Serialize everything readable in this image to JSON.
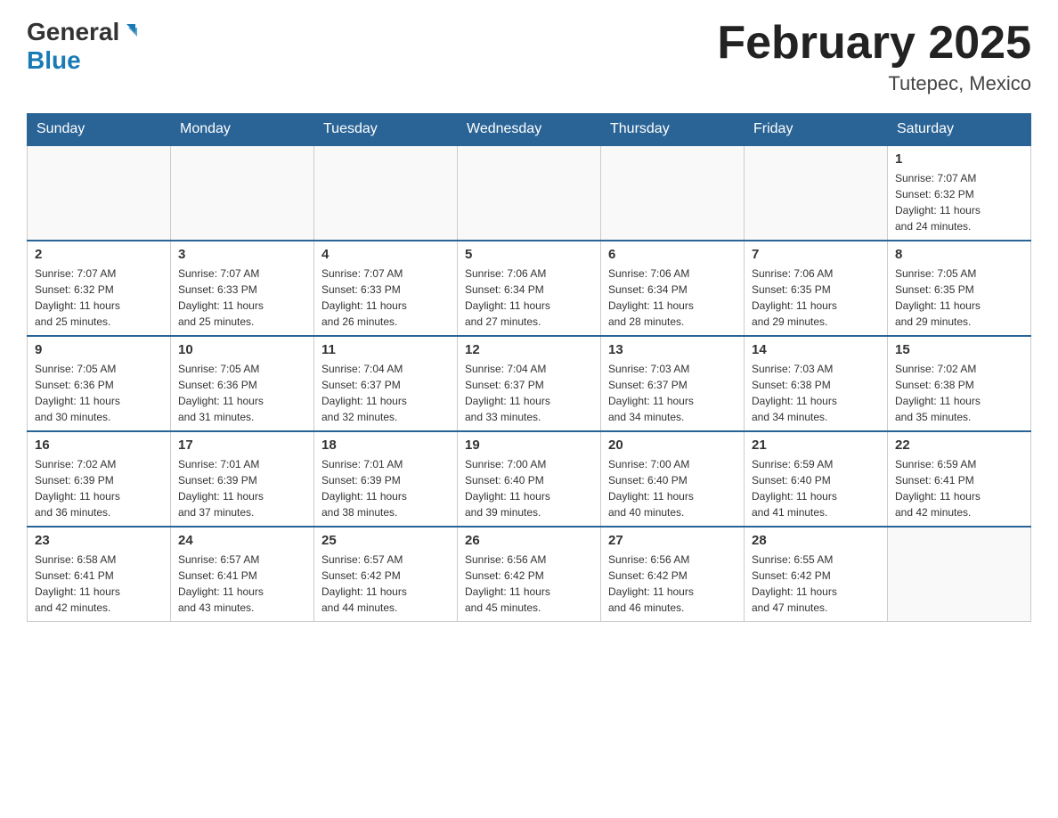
{
  "header": {
    "logo_general": "General",
    "logo_blue": "Blue",
    "month_title": "February 2025",
    "location": "Tutepec, Mexico"
  },
  "days_of_week": [
    "Sunday",
    "Monday",
    "Tuesday",
    "Wednesday",
    "Thursday",
    "Friday",
    "Saturday"
  ],
  "weeks": [
    [
      {
        "day": "",
        "info": ""
      },
      {
        "day": "",
        "info": ""
      },
      {
        "day": "",
        "info": ""
      },
      {
        "day": "",
        "info": ""
      },
      {
        "day": "",
        "info": ""
      },
      {
        "day": "",
        "info": ""
      },
      {
        "day": "1",
        "info": "Sunrise: 7:07 AM\nSunset: 6:32 PM\nDaylight: 11 hours\nand 24 minutes."
      }
    ],
    [
      {
        "day": "2",
        "info": "Sunrise: 7:07 AM\nSunset: 6:32 PM\nDaylight: 11 hours\nand 25 minutes."
      },
      {
        "day": "3",
        "info": "Sunrise: 7:07 AM\nSunset: 6:33 PM\nDaylight: 11 hours\nand 25 minutes."
      },
      {
        "day": "4",
        "info": "Sunrise: 7:07 AM\nSunset: 6:33 PM\nDaylight: 11 hours\nand 26 minutes."
      },
      {
        "day": "5",
        "info": "Sunrise: 7:06 AM\nSunset: 6:34 PM\nDaylight: 11 hours\nand 27 minutes."
      },
      {
        "day": "6",
        "info": "Sunrise: 7:06 AM\nSunset: 6:34 PM\nDaylight: 11 hours\nand 28 minutes."
      },
      {
        "day": "7",
        "info": "Sunrise: 7:06 AM\nSunset: 6:35 PM\nDaylight: 11 hours\nand 29 minutes."
      },
      {
        "day": "8",
        "info": "Sunrise: 7:05 AM\nSunset: 6:35 PM\nDaylight: 11 hours\nand 29 minutes."
      }
    ],
    [
      {
        "day": "9",
        "info": "Sunrise: 7:05 AM\nSunset: 6:36 PM\nDaylight: 11 hours\nand 30 minutes."
      },
      {
        "day": "10",
        "info": "Sunrise: 7:05 AM\nSunset: 6:36 PM\nDaylight: 11 hours\nand 31 minutes."
      },
      {
        "day": "11",
        "info": "Sunrise: 7:04 AM\nSunset: 6:37 PM\nDaylight: 11 hours\nand 32 minutes."
      },
      {
        "day": "12",
        "info": "Sunrise: 7:04 AM\nSunset: 6:37 PM\nDaylight: 11 hours\nand 33 minutes."
      },
      {
        "day": "13",
        "info": "Sunrise: 7:03 AM\nSunset: 6:37 PM\nDaylight: 11 hours\nand 34 minutes."
      },
      {
        "day": "14",
        "info": "Sunrise: 7:03 AM\nSunset: 6:38 PM\nDaylight: 11 hours\nand 34 minutes."
      },
      {
        "day": "15",
        "info": "Sunrise: 7:02 AM\nSunset: 6:38 PM\nDaylight: 11 hours\nand 35 minutes."
      }
    ],
    [
      {
        "day": "16",
        "info": "Sunrise: 7:02 AM\nSunset: 6:39 PM\nDaylight: 11 hours\nand 36 minutes."
      },
      {
        "day": "17",
        "info": "Sunrise: 7:01 AM\nSunset: 6:39 PM\nDaylight: 11 hours\nand 37 minutes."
      },
      {
        "day": "18",
        "info": "Sunrise: 7:01 AM\nSunset: 6:39 PM\nDaylight: 11 hours\nand 38 minutes."
      },
      {
        "day": "19",
        "info": "Sunrise: 7:00 AM\nSunset: 6:40 PM\nDaylight: 11 hours\nand 39 minutes."
      },
      {
        "day": "20",
        "info": "Sunrise: 7:00 AM\nSunset: 6:40 PM\nDaylight: 11 hours\nand 40 minutes."
      },
      {
        "day": "21",
        "info": "Sunrise: 6:59 AM\nSunset: 6:40 PM\nDaylight: 11 hours\nand 41 minutes."
      },
      {
        "day": "22",
        "info": "Sunrise: 6:59 AM\nSunset: 6:41 PM\nDaylight: 11 hours\nand 42 minutes."
      }
    ],
    [
      {
        "day": "23",
        "info": "Sunrise: 6:58 AM\nSunset: 6:41 PM\nDaylight: 11 hours\nand 42 minutes."
      },
      {
        "day": "24",
        "info": "Sunrise: 6:57 AM\nSunset: 6:41 PM\nDaylight: 11 hours\nand 43 minutes."
      },
      {
        "day": "25",
        "info": "Sunrise: 6:57 AM\nSunset: 6:42 PM\nDaylight: 11 hours\nand 44 minutes."
      },
      {
        "day": "26",
        "info": "Sunrise: 6:56 AM\nSunset: 6:42 PM\nDaylight: 11 hours\nand 45 minutes."
      },
      {
        "day": "27",
        "info": "Sunrise: 6:56 AM\nSunset: 6:42 PM\nDaylight: 11 hours\nand 46 minutes."
      },
      {
        "day": "28",
        "info": "Sunrise: 6:55 AM\nSunset: 6:42 PM\nDaylight: 11 hours\nand 47 minutes."
      },
      {
        "day": "",
        "info": ""
      }
    ]
  ]
}
